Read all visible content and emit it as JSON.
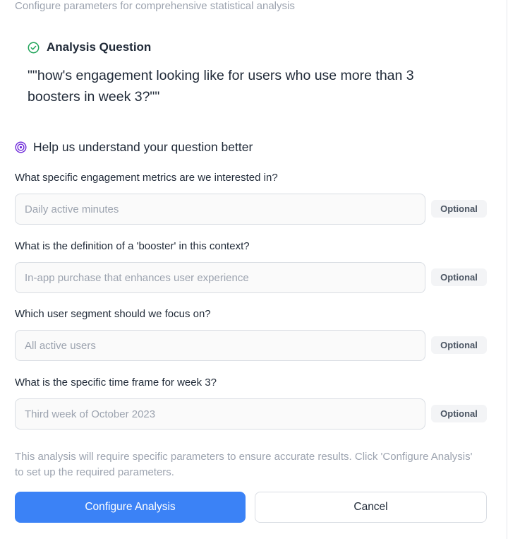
{
  "header": {
    "subtitle": "Configure parameters for comprehensive statistical analysis"
  },
  "analysis_question": {
    "icon": "check-circle-icon",
    "label": "Analysis Question",
    "text": "\"\"how's engagement looking like for users who use more than 3 boosters in week 3?\"\""
  },
  "clarification": {
    "icon": "target-icon",
    "heading": "Help us understand your question better",
    "fields": [
      {
        "label": "What specific engagement metrics are we interested in?",
        "value": "",
        "placeholder": "Daily active minutes",
        "badge": "Optional"
      },
      {
        "label": "What is the definition of a 'booster' in this context?",
        "value": "",
        "placeholder": "In-app purchase that enhances user experience",
        "badge": "Optional"
      },
      {
        "label": "Which user segment should we focus on?",
        "value": "",
        "placeholder": "All active users",
        "badge": "Optional"
      },
      {
        "label": "What is the specific time frame for week 3?",
        "value": "",
        "placeholder": "Third week of October 2023",
        "badge": "Optional"
      }
    ]
  },
  "notice": "This analysis will require specific parameters to ensure accurate results. Click 'Configure Analysis' to set up the required parameters.",
  "actions": {
    "primary_label": "Configure Analysis",
    "secondary_label": "Cancel"
  },
  "colors": {
    "accent": "#3b82f6",
    "success": "#22a55b",
    "target": "#6d28d9"
  }
}
